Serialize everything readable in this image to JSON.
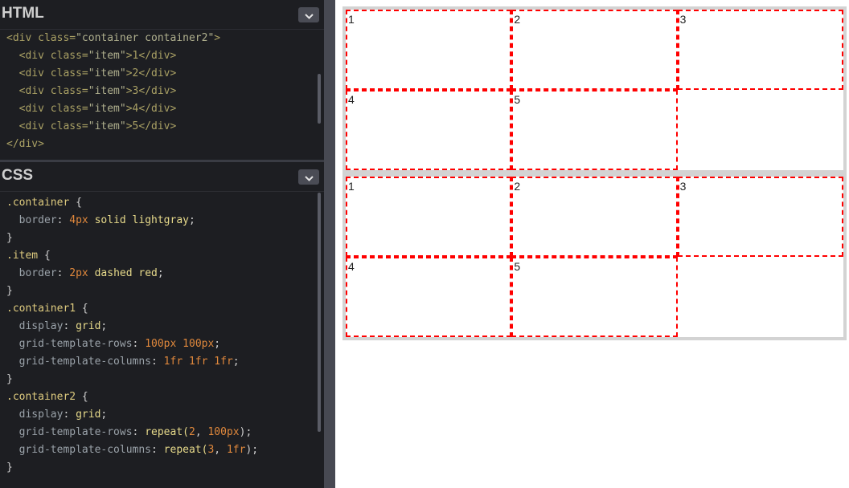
{
  "html_panel": {
    "title": "HTML",
    "lines": [
      [
        "<div class=",
        "\"container container2\"",
        ">"
      ],
      [
        "  <div class=",
        "\"item\"",
        ">1</div>"
      ],
      [
        "  <div class=",
        "\"item\"",
        ">2</div>"
      ],
      [
        "  <div class=",
        "\"item\"",
        ">3</div>"
      ],
      [
        "  <div class=",
        "\"item\"",
        ">4</div>"
      ],
      [
        "  <div class=",
        "\"item\"",
        ">5</div>"
      ],
      [
        "</div>",
        "",
        ""
      ]
    ]
  },
  "css_panel": {
    "title": "CSS",
    "lines": [
      [
        {
          "t": ".container",
          "c": "sel"
        },
        {
          "t": " {",
          "c": "punct"
        }
      ],
      [
        {
          "t": "  border",
          "c": "prop"
        },
        {
          "t": ": ",
          "c": "punct"
        },
        {
          "t": "4px",
          "c": "num"
        },
        {
          "t": " solid lightgray",
          "c": "val"
        },
        {
          "t": ";",
          "c": "punct"
        }
      ],
      [
        {
          "t": "}",
          "c": "punct"
        }
      ],
      [
        {
          "t": ".item",
          "c": "sel"
        },
        {
          "t": " {",
          "c": "punct"
        }
      ],
      [
        {
          "t": "  border",
          "c": "prop"
        },
        {
          "t": ": ",
          "c": "punct"
        },
        {
          "t": "2px",
          "c": "num"
        },
        {
          "t": " dashed red",
          "c": "val"
        },
        {
          "t": ";",
          "c": "punct"
        }
      ],
      [
        {
          "t": "}",
          "c": "punct"
        }
      ],
      [
        {
          "t": ".container1",
          "c": "sel"
        },
        {
          "t": " {",
          "c": "punct"
        }
      ],
      [
        {
          "t": "  display",
          "c": "prop"
        },
        {
          "t": ": ",
          "c": "punct"
        },
        {
          "t": "grid",
          "c": "val"
        },
        {
          "t": ";",
          "c": "punct"
        }
      ],
      [
        {
          "t": "  grid-template-rows",
          "c": "prop"
        },
        {
          "t": ": ",
          "c": "punct"
        },
        {
          "t": "100px 100px",
          "c": "num"
        },
        {
          "t": ";",
          "c": "punct"
        }
      ],
      [
        {
          "t": "  grid-template-columns",
          "c": "prop"
        },
        {
          "t": ": ",
          "c": "punct"
        },
        {
          "t": "1fr 1fr 1fr",
          "c": "num"
        },
        {
          "t": ";",
          "c": "punct"
        }
      ],
      [
        {
          "t": "}",
          "c": "punct"
        }
      ],
      [
        {
          "t": ".container2",
          "c": "sel"
        },
        {
          "t": " {",
          "c": "punct"
        }
      ],
      [
        {
          "t": "  display",
          "c": "prop"
        },
        {
          "t": ": ",
          "c": "punct"
        },
        {
          "t": "grid",
          "c": "val"
        },
        {
          "t": ";",
          "c": "punct"
        }
      ],
      [
        {
          "t": "  grid-template-rows",
          "c": "prop"
        },
        {
          "t": ": ",
          "c": "punct"
        },
        {
          "t": "repeat(",
          "c": "val"
        },
        {
          "t": "2",
          "c": "num"
        },
        {
          "t": ", ",
          "c": "punct"
        },
        {
          "t": "100px",
          "c": "num"
        },
        {
          "t": ");",
          "c": "punct"
        }
      ],
      [
        {
          "t": "  grid-template-columns",
          "c": "prop"
        },
        {
          "t": ": ",
          "c": "punct"
        },
        {
          "t": "repeat(",
          "c": "val"
        },
        {
          "t": "3",
          "c": "num"
        },
        {
          "t": ", ",
          "c": "punct"
        },
        {
          "t": "1fr",
          "c": "num"
        },
        {
          "t": ");",
          "c": "punct"
        }
      ],
      [
        {
          "t": "}",
          "c": "punct"
        }
      ]
    ]
  },
  "result": {
    "containers": [
      {
        "items": [
          "1",
          "2",
          "3",
          "4",
          "5"
        ]
      },
      {
        "items": [
          "1",
          "2",
          "3",
          "4",
          "5"
        ]
      }
    ]
  },
  "icons": {
    "collapse": "chevron-down-icon"
  },
  "colors": {
    "editor_bg": "#1d1e22",
    "divider": "#474952",
    "item_border": "red",
    "container_border": "lightgray"
  }
}
